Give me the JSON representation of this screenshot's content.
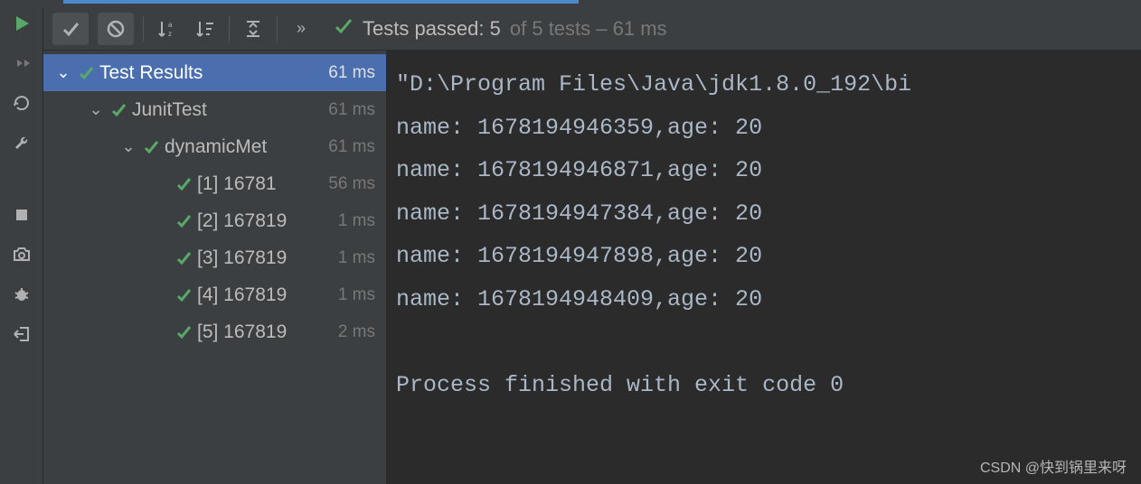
{
  "status": {
    "prefix": "Tests passed:",
    "passed_count": "5",
    "suffix": "of 5 tests – 61 ms"
  },
  "tree": {
    "root": {
      "label": "Test Results",
      "time": "61 ms"
    },
    "suite": {
      "label": "JunitTest",
      "time": "61 ms"
    },
    "group": {
      "label": "dynamicMet",
      "time": "61 ms"
    },
    "tests": [
      {
        "label": "[1] 16781",
        "time": "56 ms"
      },
      {
        "label": "[2] 167819",
        "time": "1 ms"
      },
      {
        "label": "[3] 167819",
        "time": "1 ms"
      },
      {
        "label": "[4] 167819",
        "time": "1 ms"
      },
      {
        "label": "[5] 167819",
        "time": "2 ms"
      }
    ]
  },
  "console": {
    "cmd": "\"D:\\Program Files\\Java\\jdk1.8.0_192\\bi",
    "lines": [
      "name: 1678194946359,age: 20",
      "name: 1678194946871,age: 20",
      "name: 1678194947384,age: 20",
      "name: 1678194947898,age: 20",
      "name: 1678194948409,age: 20"
    ],
    "exit": "Process finished with exit code 0"
  },
  "watermark": "CSDN @快到锅里来呀"
}
